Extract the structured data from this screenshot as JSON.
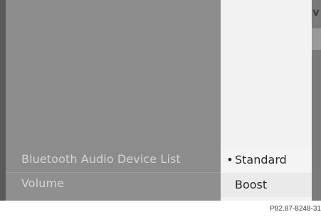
{
  "main_menu": {
    "items": [
      {
        "label": "Bluetooth Audio Device List"
      },
      {
        "label": "Volume"
      }
    ]
  },
  "submenu": {
    "options": [
      {
        "label": "Standard",
        "bullet": "•",
        "selected": true
      },
      {
        "label": "Boost",
        "bullet": "",
        "selected": false
      }
    ]
  },
  "edge_glyph": "v",
  "caption": "P82.87-8248-31",
  "colors": {
    "main_panel": "#8c8c8c",
    "submenu_bg": "#f2f2f2",
    "main_text": "#d4d4d4",
    "submenu_text": "#2a2a2a"
  }
}
